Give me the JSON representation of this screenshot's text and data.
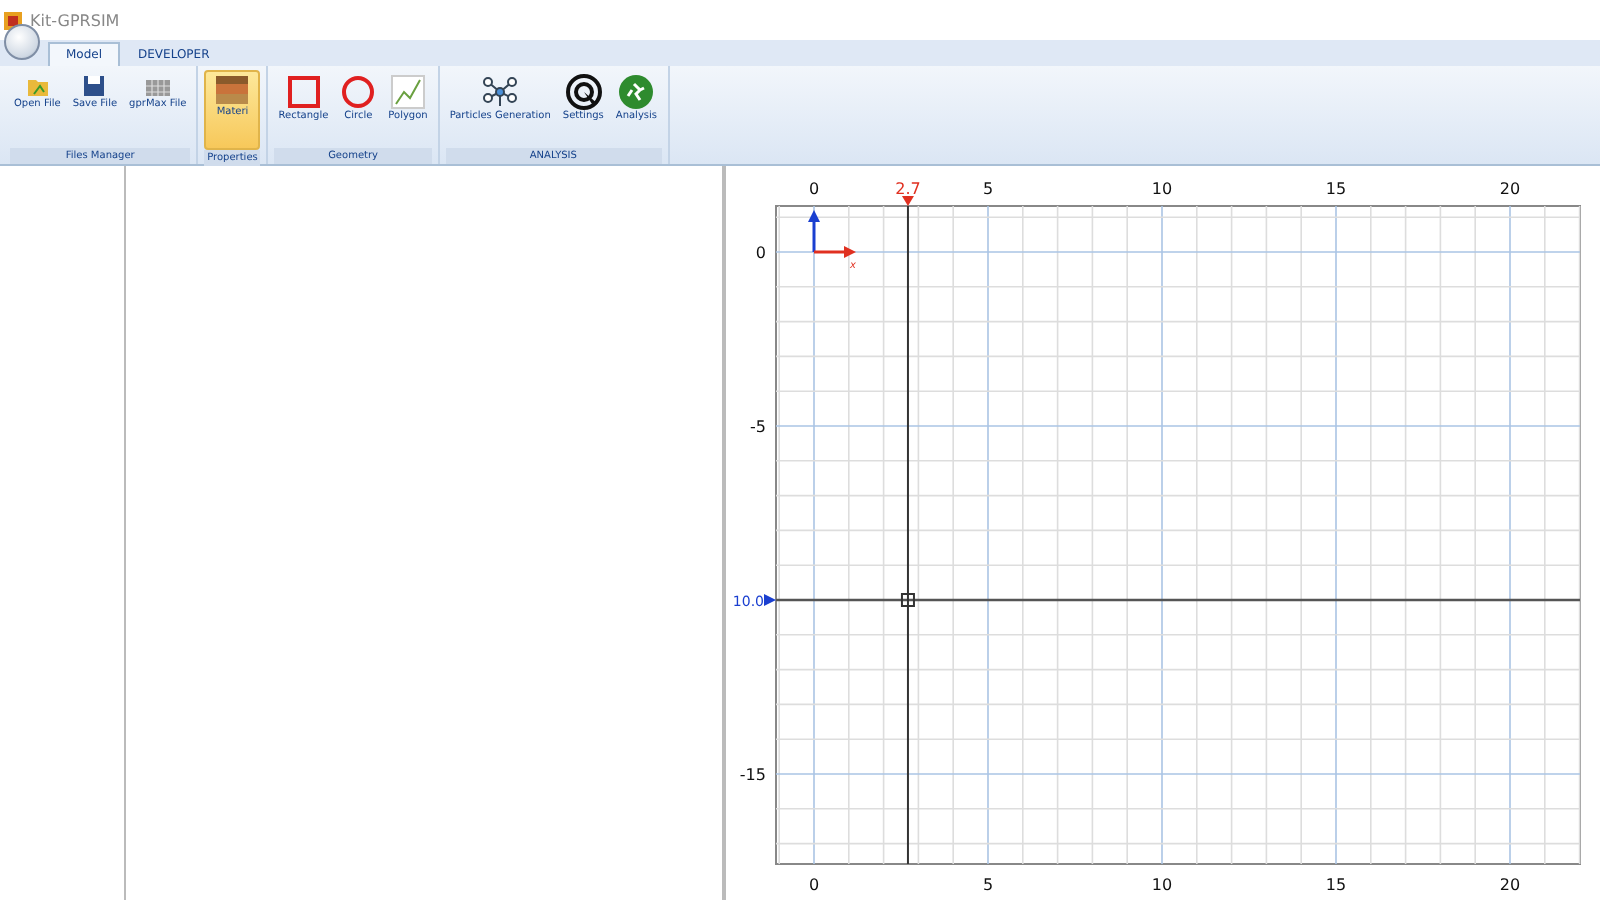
{
  "window": {
    "title": "Kit-GPRSIM"
  },
  "tabs": [
    {
      "label": "Model",
      "selected": true
    },
    {
      "label": "DEVELOPER",
      "selected": false
    }
  ],
  "ribbon": [
    {
      "group": "Files Manager",
      "buttons": [
        {
          "label": "Open File",
          "selected": false
        },
        {
          "label": "Save File",
          "selected": false
        },
        {
          "label": "gprMax File",
          "selected": false
        }
      ]
    },
    {
      "group": "Properties",
      "buttons": [
        {
          "label": "Materi",
          "selected": true
        }
      ]
    },
    {
      "group": "Geometry",
      "buttons": [
        {
          "label": "Rectangle",
          "selected": false
        },
        {
          "label": "Circle",
          "selected": false
        },
        {
          "label": "Polygon",
          "selected": false
        }
      ]
    },
    {
      "group": "ANALYSIS",
      "buttons": [
        {
          "label": "Particles Generation",
          "selected": false
        },
        {
          "label": "Settings",
          "selected": false
        },
        {
          "label": "Analysis",
          "selected": false
        }
      ]
    }
  ],
  "canvas": {
    "top_x_ticks": [
      "0",
      "5",
      "10",
      "15",
      "20"
    ],
    "bottom_x_ticks": [
      "0",
      "5",
      "10",
      "15",
      "20"
    ],
    "y_ticks": [
      "0",
      "-5",
      "-15"
    ],
    "cursor_x_label": "2.7",
    "cursor_y_label": "10.0",
    "axis_x_label": "x"
  }
}
